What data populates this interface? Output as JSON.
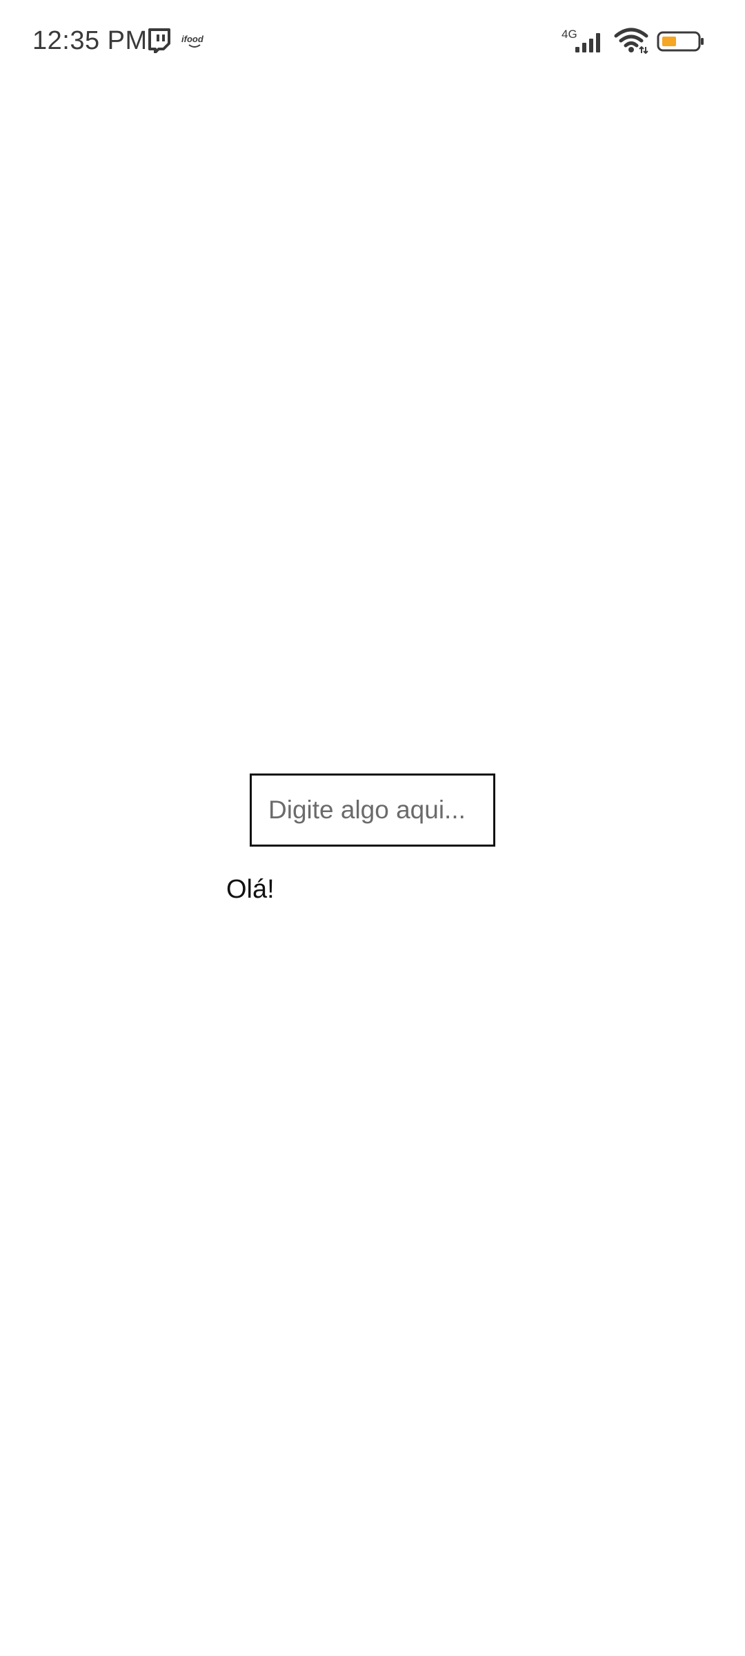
{
  "status_bar": {
    "time": "12:35 PM",
    "notification_icons": [
      "twitch-icon",
      "ifood-icon"
    ],
    "network_type": "4G",
    "battery_color": "#F5A623"
  },
  "main": {
    "input": {
      "value": "",
      "placeholder": "Digite algo aqui..."
    },
    "greeting_text": "Olá!"
  }
}
